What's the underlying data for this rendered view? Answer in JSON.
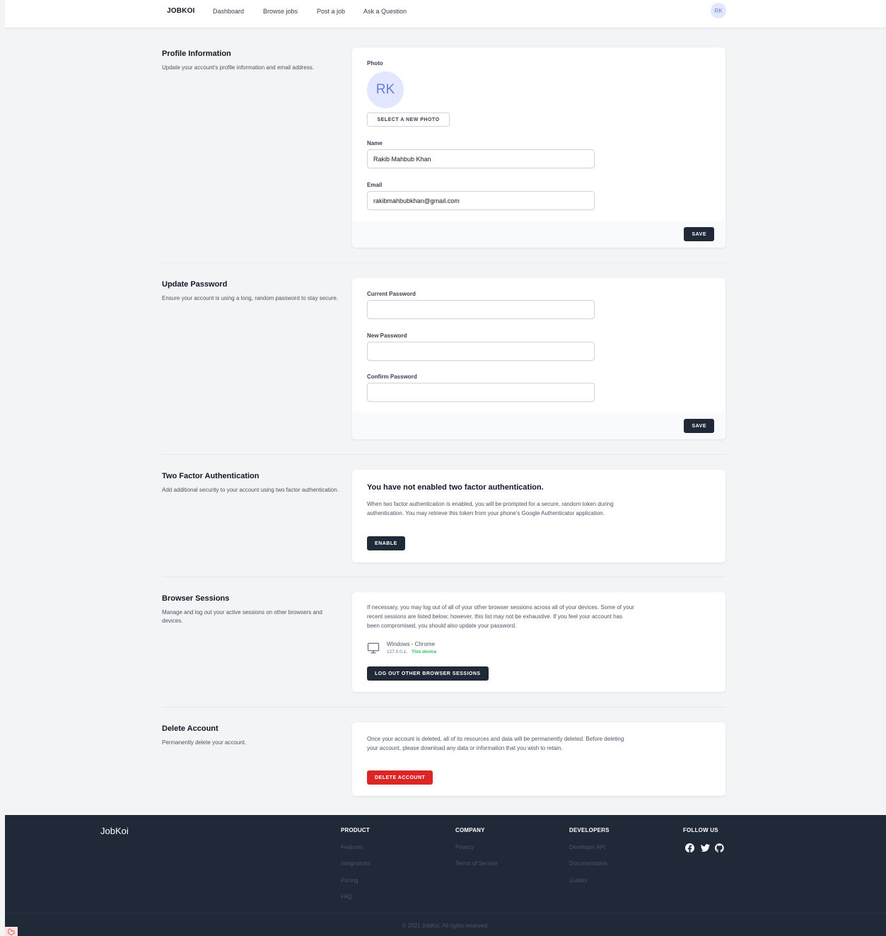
{
  "nav": {
    "brand": "JOBKOI",
    "links": [
      "Dashboard",
      "Browse jobs",
      "Post a job",
      "Ask a Question"
    ],
    "avatar_initials": "RK"
  },
  "profile": {
    "title": "Profile Information",
    "description": "Update your account's profile information and email address.",
    "photo_label": "Photo",
    "avatar_initials": "RK",
    "select_photo_label": "Select a new photo",
    "name_label": "Name",
    "name_value": "Rakib Mahbub Khan",
    "email_label": "Email",
    "email_value": "rakibmahbubkhan@gmail.com",
    "save_label": "Save"
  },
  "password": {
    "title": "Update Password",
    "description": "Ensure your account is using a long, random password to stay secure.",
    "current_label": "Current Password",
    "new_label": "New Password",
    "confirm_label": "Confirm Password",
    "save_label": "Save"
  },
  "two_factor": {
    "title": "Two Factor Authentication",
    "description": "Add additional security to your account using two factor authentication.",
    "heading": "You have not enabled two factor authentication.",
    "text": "When two factor authentication is enabled, you will be prompted for a secure, random token during authentication. You may retrieve this token from your phone's Google Authenticator application.",
    "enable_label": "Enable"
  },
  "sessions": {
    "title": "Browser Sessions",
    "description": "Manage and log out your active sessions on other browsers and devices.",
    "text": "If necessary, you may log out of all of your other browser sessions across all of your devices. Some of your recent sessions are listed below; however, this list may not be exhaustive. If you feel your account has been compromised, you should also update your password.",
    "device_name": "Windows - Chrome",
    "device_ip": "127.0.0.1,",
    "device_current": "This device",
    "device_icon": "desktop-icon",
    "logout_label": "Log out other browser sessions"
  },
  "delete": {
    "title": "Delete Account",
    "description": "Permanently delete your account.",
    "text": "Once your account is deleted, all of its resources and data will be permanently deleted. Before deleting your account, please download any data or information that you wish to retain.",
    "delete_label": "Delete account"
  },
  "footer": {
    "brand": "JobKoi",
    "product": {
      "heading": "PRODUCT",
      "links": [
        "Features",
        "Integrations",
        "Pricing",
        "FAQ"
      ]
    },
    "company": {
      "heading": "COMPANY",
      "links": [
        "Privacy",
        "Terms of Service"
      ]
    },
    "developers": {
      "heading": "DEVELOPERS",
      "links": [
        "Developer API",
        "Documentation",
        "Guides"
      ]
    },
    "follow": {
      "heading": "FOLLOW US",
      "icons": [
        "facebook-icon",
        "twitter-icon",
        "github-icon"
      ]
    },
    "copyright": "© 2021 JobKoi. All rights reserved."
  },
  "colors": {
    "dark_button": "#1f2937",
    "danger": "#dc2626",
    "success_text": "#22c55e",
    "avatar_bg": "#e0e7ff",
    "avatar_text": "#6b7cd8",
    "page_bg": "#f3f4f6"
  }
}
